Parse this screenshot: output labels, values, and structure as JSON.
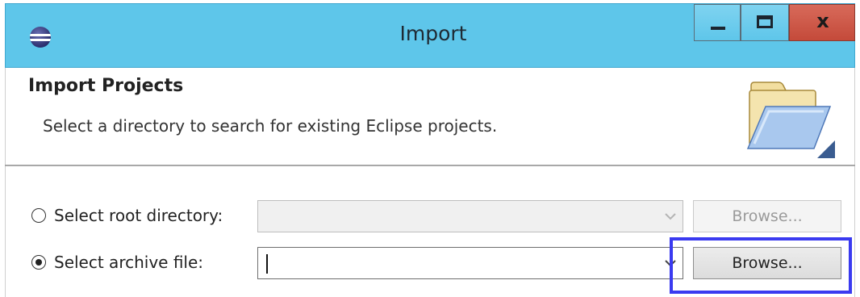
{
  "window": {
    "title": "Import",
    "close_glyph": "x",
    "icons": {
      "app": "eclipse-icon",
      "minimize": "minimize-icon",
      "maximize": "maximize-icon",
      "close": "close-icon",
      "folder": "open-folder-icon"
    }
  },
  "header": {
    "title": "Import Projects",
    "description": "Select a directory to search for existing Eclipse projects."
  },
  "options": {
    "root_directory": {
      "label": "Select root directory:",
      "selected": false,
      "value": "",
      "browse_label": "Browse...",
      "enabled": false
    },
    "archive_file": {
      "label": "Select archive file:",
      "selected": true,
      "value": "",
      "browse_label": "Browse...",
      "enabled": true
    }
  },
  "colors": {
    "titlebar": "#5ec6ea",
    "close_button": "#c44a3a",
    "highlight_box": "#3a3af0"
  }
}
